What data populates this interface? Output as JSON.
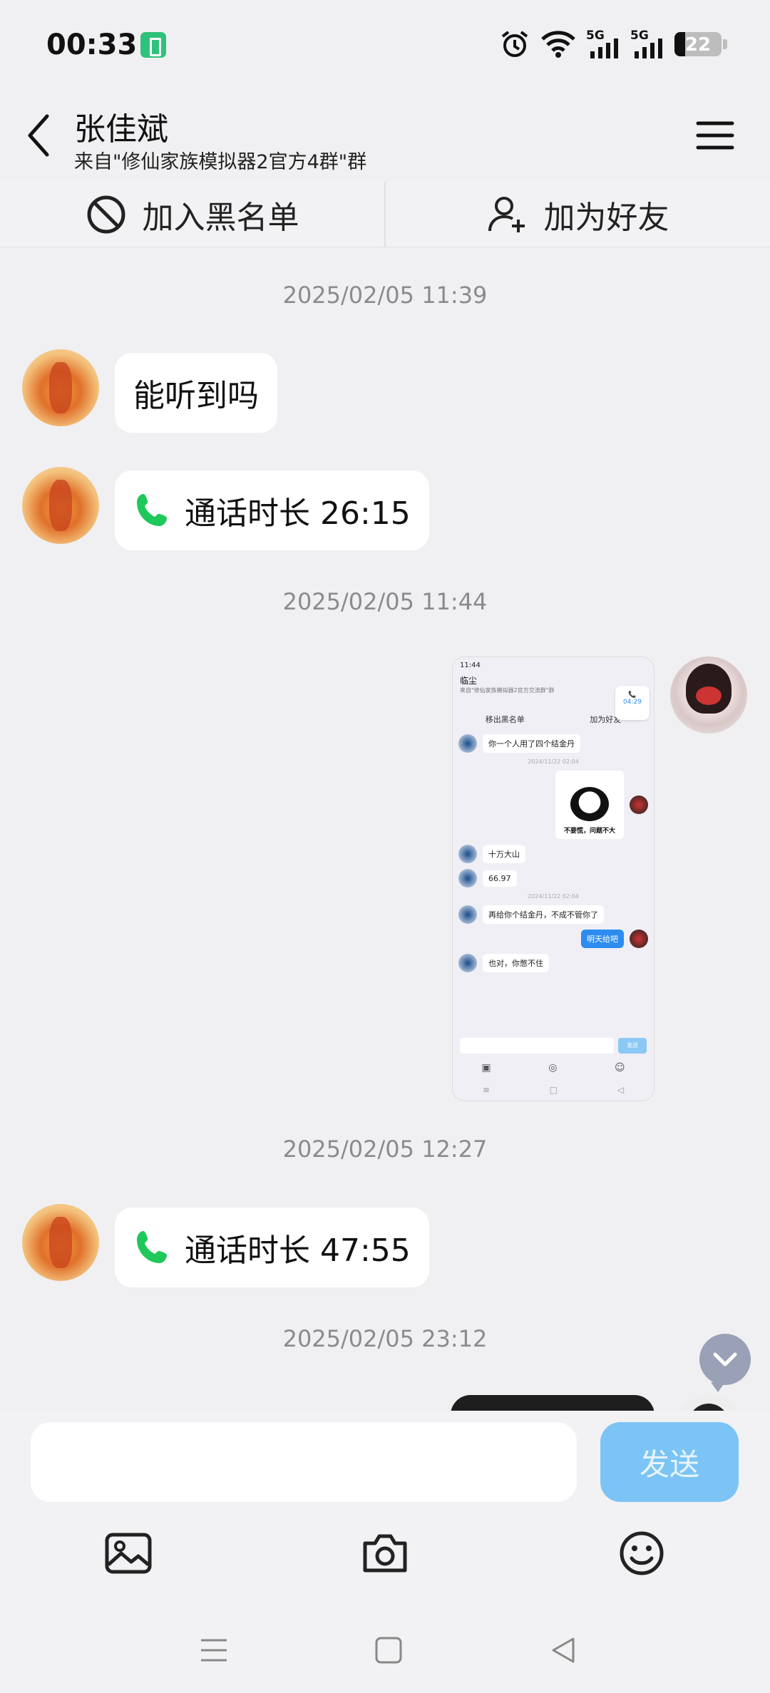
{
  "status_bar": {
    "time": "00:33",
    "network_1": "5G",
    "network_2": "5G",
    "battery_level": "22",
    "battery_fraction": 0.22
  },
  "header": {
    "name": "张佳斌",
    "subtitle": "来自\"修仙家族模拟器2官方4群\"群"
  },
  "actions": {
    "blacklist_label": "加入黑名单",
    "add_friend_label": "加为好友"
  },
  "messages": {
    "ts1": "2025/02/05 11:39",
    "m1_text": "能听到吗",
    "m2_call": "通话时长 26:15",
    "ts2": "2025/02/05 11:44",
    "ts3": "2025/02/05 12:27",
    "m4_call": "通话时长 47:55",
    "ts4": "2025/02/05 23:12"
  },
  "shared_screenshot": {
    "time": "11:44",
    "name": "临尘",
    "subtitle": "来自\"修仙家族模拟器2官方交流群\"群",
    "action_left": "移出黑名单",
    "action_right": "加为好友",
    "call_badge": "04:29",
    "msg1": "你一个人用了四个结金丹",
    "ts1": "2024/11/22 02:04",
    "sticker_caption": "不要慌，问题不大",
    "msg2": "十万大山",
    "msg3": "66.97",
    "ts2": "2024/11/22 02:04",
    "msg4": "再给你个结金丹，不成不管你了",
    "msg5": "明天给吧",
    "msg6": "也对，你憋不住",
    "send": "发送"
  },
  "input": {
    "placeholder": "",
    "send_label": "发送"
  },
  "colors": {
    "accent_blue": "#7cc4f5",
    "call_green": "#1ec85a",
    "background": "#f0f0f2"
  }
}
